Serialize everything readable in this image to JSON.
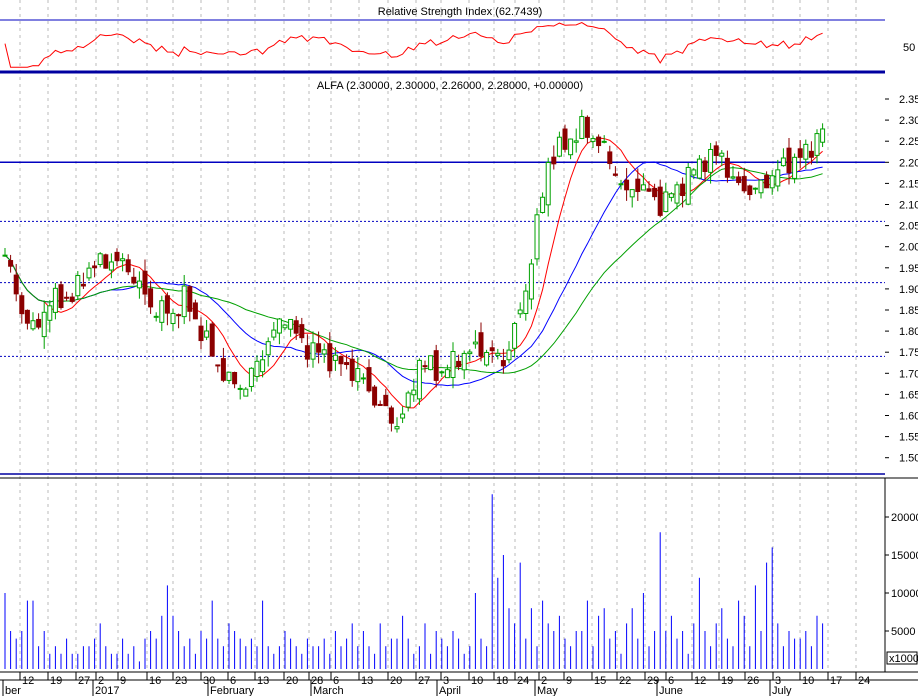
{
  "chart_data": {
    "type": "candlestick",
    "symbol_title": "ALFA (2.30000, 2.30000, 2.26000, 2.28000, +0.00000)",
    "rsi_title": "Relative Strength Index (62.7439)",
    "rsi_ticks": [
      "50"
    ],
    "price_ticks": [
      "2.35",
      "2.30",
      "2.25",
      "2.20",
      "2.15",
      "2.10",
      "2.05",
      "2.00",
      "1.95",
      "1.90",
      "1.85",
      "1.80",
      "1.75",
      "1.70",
      "1.65",
      "1.60",
      "1.55",
      "1.50"
    ],
    "volume_ticks": [
      "20000",
      "15000",
      "10000",
      "5000"
    ],
    "volume_unit": "x1000",
    "x_day_labels": [
      "12",
      "19",
      "27",
      "2",
      "9",
      "16",
      "23",
      "30",
      "6",
      "13",
      "20",
      "28",
      "6",
      "13",
      "20",
      "27",
      "3",
      "10",
      "18",
      "24",
      "2",
      "9",
      "15",
      "22",
      "29",
      "6",
      "12",
      "19",
      "26",
      "3",
      "10",
      "17",
      "24"
    ],
    "x_month_labels": [
      "ber",
      "2017",
      "February",
      "March",
      "April",
      "May",
      "June",
      "July"
    ],
    "horizontal_levels": [
      2.2,
      2.06,
      1.915,
      1.74
    ],
    "price_range": [
      1.5,
      2.35
    ],
    "close_keypoints": [
      [
        0,
        1.98
      ],
      [
        3,
        1.85
      ],
      [
        5,
        1.8
      ],
      [
        8,
        1.87
      ],
      [
        12,
        1.88
      ],
      [
        15,
        1.95
      ],
      [
        19,
        1.97
      ],
      [
        22,
        1.95
      ],
      [
        26,
        1.86
      ],
      [
        30,
        1.84
      ],
      [
        32,
        1.88
      ],
      [
        35,
        1.8
      ],
      [
        38,
        1.72
      ],
      [
        40,
        1.68
      ],
      [
        43,
        1.67
      ],
      [
        46,
        1.75
      ],
      [
        50,
        1.84
      ],
      [
        53,
        1.77
      ],
      [
        56,
        1.75
      ],
      [
        60,
        1.72
      ],
      [
        63,
        1.7
      ],
      [
        67,
        1.62
      ],
      [
        70,
        1.58
      ],
      [
        72,
        1.63
      ],
      [
        74,
        1.73
      ],
      [
        78,
        1.7
      ],
      [
        81,
        1.74
      ],
      [
        85,
        1.76
      ],
      [
        89,
        1.73
      ],
      [
        91,
        1.8
      ],
      [
        93,
        1.9
      ],
      [
        95,
        2.05
      ],
      [
        97,
        2.2
      ],
      [
        99,
        2.23
      ],
      [
        103,
        2.28
      ],
      [
        106,
        2.25
      ],
      [
        109,
        2.18
      ],
      [
        111,
        2.12
      ],
      [
        113,
        2.15
      ],
      [
        117,
        2.1
      ],
      [
        121,
        2.15
      ],
      [
        124,
        2.2
      ],
      [
        128,
        2.22
      ],
      [
        130,
        2.15
      ],
      [
        134,
        2.13
      ],
      [
        137,
        2.17
      ],
      [
        140,
        2.2
      ],
      [
        143,
        2.22
      ],
      [
        146,
        2.28
      ]
    ],
    "volume_thousands": [
      10,
      5,
      4,
      5,
      9,
      9,
      3,
      5,
      2,
      3,
      2,
      4,
      2,
      2,
      3,
      3,
      4,
      6,
      3,
      2,
      2,
      4,
      2,
      3,
      1,
      4,
      5,
      4,
      7,
      11,
      7,
      5,
      3,
      4,
      2,
      5,
      4,
      9,
      4,
      3,
      6,
      5,
      4,
      3,
      4,
      3,
      9,
      3,
      2,
      3,
      5,
      4,
      3,
      2,
      4,
      3,
      3,
      4,
      2,
      5,
      3,
      4,
      6,
      3,
      5,
      3,
      2,
      6,
      3,
      4,
      4,
      7,
      4,
      2,
      3,
      6,
      2,
      5,
      4,
      3,
      5,
      4,
      2,
      3,
      10,
      4,
      3,
      23,
      12,
      15,
      8,
      6,
      14,
      4,
      8,
      3,
      9,
      6,
      5,
      7,
      4,
      3,
      5,
      5,
      9,
      3,
      7,
      8,
      4,
      5,
      2,
      6,
      8,
      4,
      10,
      3,
      5,
      18,
      5,
      7,
      4,
      5,
      2,
      6,
      12,
      5,
      3,
      6,
      8,
      4,
      3,
      9,
      7,
      3,
      11,
      5,
      14,
      16,
      6,
      3,
      5,
      4,
      4,
      5,
      3,
      7,
      6
    ],
    "colors": {
      "up": "#00a000",
      "down": "#8b0000",
      "rsi": "#ff0000",
      "ma_short": "#ff0000",
      "ma_mid": "#0000ff",
      "ma_long": "#00a000",
      "volume": "#0000ff",
      "level": "#0000c0"
    }
  }
}
